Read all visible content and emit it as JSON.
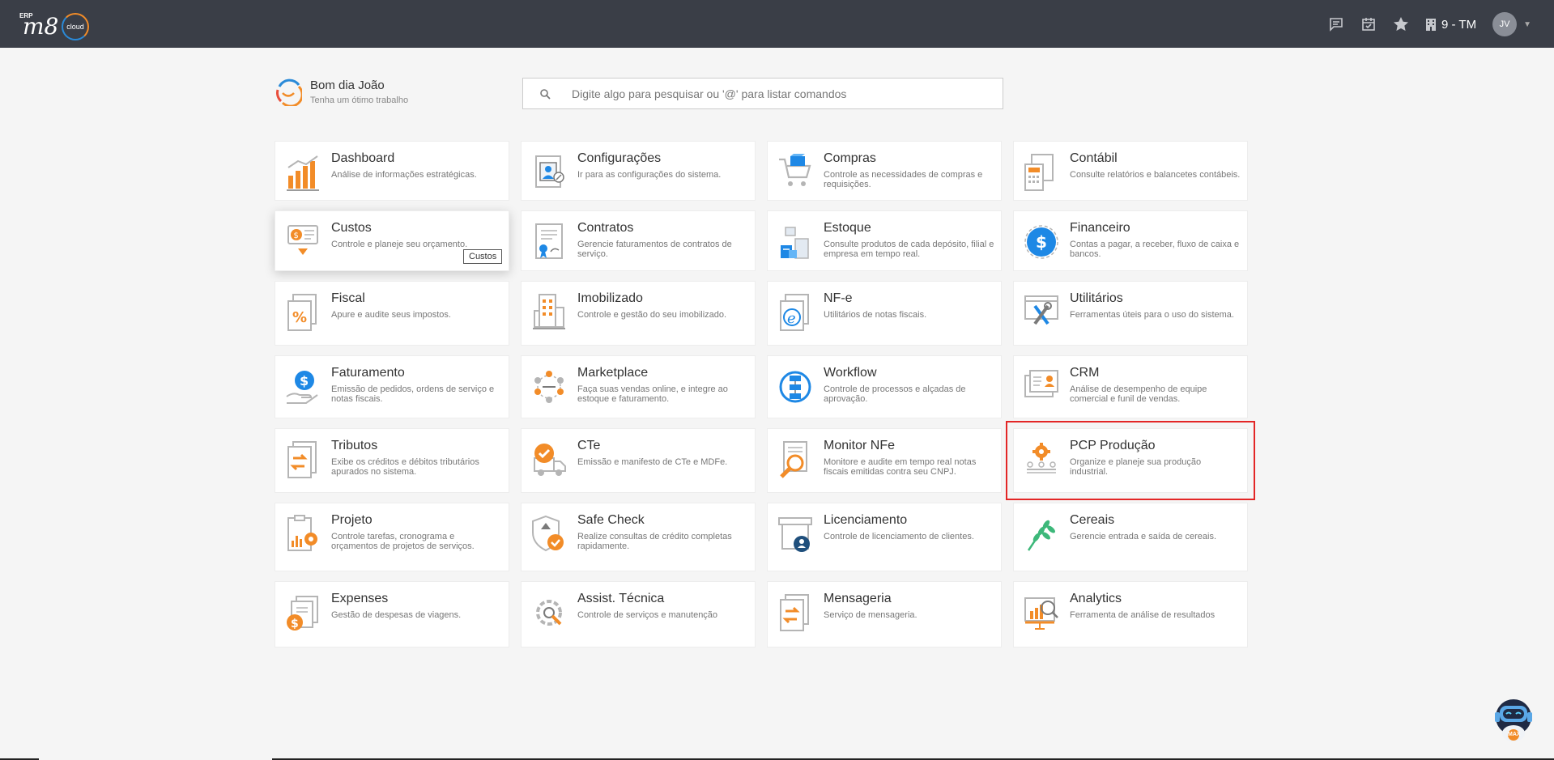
{
  "header": {
    "logo": {
      "erp": "ERP",
      "brand": "m8",
      "cloud": "cloud"
    },
    "icons": [
      "chat-icon",
      "calendar-check-icon",
      "star-icon",
      "building-icon"
    ],
    "company": "9 - TM",
    "user_initials": "JV"
  },
  "greeting": {
    "title": "Bom dia João",
    "subtitle": "Tenha um ótimo trabalho"
  },
  "search": {
    "placeholder": "Digite algo para pesquisar ou '@' para listar comandos"
  },
  "tooltip": "Custos",
  "modules": [
    {
      "id": "dashboard",
      "title": "Dashboard",
      "desc": "Análise de informações estratégicas."
    },
    {
      "id": "configuracoes",
      "title": "Configurações",
      "desc": "Ir para as configurações do sistema."
    },
    {
      "id": "compras",
      "title": "Compras",
      "desc": "Controle as necessidades de compras e requisições."
    },
    {
      "id": "contabil",
      "title": "Contábil",
      "desc": "Consulte relatórios e balancetes contábeis."
    },
    {
      "id": "custos",
      "title": "Custos",
      "desc": "Controle e planeje seu orçamento."
    },
    {
      "id": "contratos",
      "title": "Contratos",
      "desc": "Gerencie faturamentos de contratos de serviço."
    },
    {
      "id": "estoque",
      "title": "Estoque",
      "desc": "Consulte produtos de cada depósito, filial e empresa em tempo real."
    },
    {
      "id": "financeiro",
      "title": "Financeiro",
      "desc": "Contas a pagar, a receber, fluxo de caixa e bancos."
    },
    {
      "id": "fiscal",
      "title": "Fiscal",
      "desc": "Apure e audite seus impostos."
    },
    {
      "id": "imobilizado",
      "title": "Imobilizado",
      "desc": "Controle e gestão do seu imobilizado."
    },
    {
      "id": "nfe",
      "title": "NF-e",
      "desc": "Utilitários de notas fiscais."
    },
    {
      "id": "utilitarios",
      "title": "Utilitários",
      "desc": "Ferramentas úteis para o uso do sistema."
    },
    {
      "id": "faturamento",
      "title": "Faturamento",
      "desc": "Emissão de pedidos, ordens de serviço e notas fiscais."
    },
    {
      "id": "marketplace",
      "title": "Marketplace",
      "desc": "Faça suas vendas online, e integre ao estoque e faturamento."
    },
    {
      "id": "workflow",
      "title": "Workflow",
      "desc": "Controle de processos e alçadas de aprovação."
    },
    {
      "id": "crm",
      "title": "CRM",
      "desc": "Análise de desempenho de equipe comercial e funil de vendas."
    },
    {
      "id": "tributos",
      "title": "Tributos",
      "desc": "Exibe os créditos e débitos tributários apurados no sistema."
    },
    {
      "id": "cte",
      "title": "CTe",
      "desc": "Emissão e manifesto de CTe e MDFe."
    },
    {
      "id": "monitor-nfe",
      "title": "Monitor NFe",
      "desc": "Monitore e audite em tempo real notas fiscais emitidas contra seu CNPJ."
    },
    {
      "id": "pcp-producao",
      "title": "PCP Produção",
      "desc": "Organize e planeje sua produção industrial."
    },
    {
      "id": "projeto",
      "title": "Projeto",
      "desc": "Controle tarefas, cronograma e orçamentos de projetos de serviços."
    },
    {
      "id": "safe-check",
      "title": "Safe Check",
      "desc": "Realize consultas de crédito completas rapidamente."
    },
    {
      "id": "licenciamento",
      "title": "Licenciamento",
      "desc": "Controle de licenciamento de clientes."
    },
    {
      "id": "cereais",
      "title": "Cereais",
      "desc": "Gerencie entrada e saída de cereais."
    },
    {
      "id": "expenses",
      "title": "Expenses",
      "desc": "Gestão de despesas de viagens."
    },
    {
      "id": "assist-tecnica",
      "title": "Assist. Técnica",
      "desc": "Controle de serviços e manutenção"
    },
    {
      "id": "mensageria",
      "title": "Mensageria",
      "desc": "Serviço de mensageria."
    },
    {
      "id": "analytics",
      "title": "Analytics",
      "desc": "Ferramenta de análise de resultados"
    }
  ],
  "assistant": {
    "label": "MAX"
  },
  "colors": {
    "orange": "#f28c28",
    "blue": "#1e88e5",
    "gray": "#9a9a9a",
    "highlight": "#e32626"
  }
}
